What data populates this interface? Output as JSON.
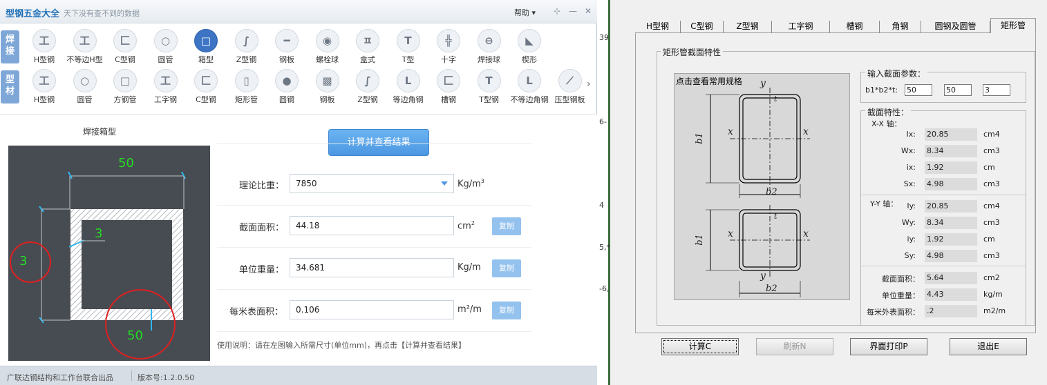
{
  "left_app": {
    "title": "型钢五金大全",
    "subtitle": "天下没有查不到的数据",
    "help_label": "帮助 ▾",
    "controls": {
      "pin": "⊹",
      "minimize": "—",
      "close": "✕"
    },
    "weld_row": {
      "tag": "焊\n接",
      "items": [
        {
          "label": "H型钢",
          "glyph": "工"
        },
        {
          "label": "不等边H型",
          "glyph": "工"
        },
        {
          "label": "C型钢",
          "glyph": "匚"
        },
        {
          "label": "圆管",
          "glyph": "○"
        },
        {
          "label": "箱型",
          "glyph": "□"
        },
        {
          "label": "Z型钢",
          "glyph": "∫"
        },
        {
          "label": "钢板",
          "glyph": "━"
        },
        {
          "label": "螺栓球",
          "glyph": "◉"
        },
        {
          "label": "盒式",
          "glyph": "ㅍ"
        },
        {
          "label": "T型",
          "glyph": "T"
        },
        {
          "label": "十字",
          "glyph": "╬"
        },
        {
          "label": "焊接球",
          "glyph": "⊖"
        },
        {
          "label": "楔形",
          "glyph": "◣"
        }
      ]
    },
    "section_row": {
      "tag": "型\n材",
      "items": [
        {
          "label": "H型钢",
          "glyph": "工"
        },
        {
          "label": "圆管",
          "glyph": "○"
        },
        {
          "label": "方钢管",
          "glyph": "□"
        },
        {
          "label": "工字钢",
          "glyph": "工"
        },
        {
          "label": "C型钢",
          "glyph": "匚"
        },
        {
          "label": "矩形管",
          "glyph": "▯"
        },
        {
          "label": "圆钢",
          "glyph": "●"
        },
        {
          "label": "钢板",
          "glyph": "▩"
        },
        {
          "label": "Z型钢",
          "glyph": "∫"
        },
        {
          "label": "等边角钢",
          "glyph": "L"
        },
        {
          "label": "槽钢",
          "glyph": "匚"
        },
        {
          "label": "T型钢",
          "glyph": "T"
        },
        {
          "label": "不等边角钢",
          "glyph": "L"
        },
        {
          "label": "压型钢板",
          "glyph": "⟋"
        }
      ]
    },
    "scroll_arrow": "›",
    "diagram_title": "焊接箱型",
    "diagram_dims": {
      "width": "50",
      "thickness_inner": "3",
      "thickness_side": "3",
      "bottom": "50"
    },
    "calc_button": "计算并查看结果",
    "fields": [
      {
        "label": "理论比重：",
        "value": "7850",
        "unit": "Kg/m",
        "unit_sup": "3",
        "has_dropdown": true,
        "has_copy": false
      },
      {
        "label": "截面面积：",
        "value": "44.18",
        "unit": "cm",
        "unit_sup": "2",
        "has_dropdown": false,
        "has_copy": true
      },
      {
        "label": "单位重量：",
        "value": "34.681",
        "unit": "Kg/m",
        "unit_sup": "",
        "has_dropdown": false,
        "has_copy": true
      },
      {
        "label": "每米表面积：",
        "value": "0.106",
        "unit": "m²/m",
        "unit_sup": "",
        "has_dropdown": false,
        "has_copy": true
      }
    ],
    "copy_label": "复制",
    "usage_note": "使用说明：请在左图输入所需尺寸(单位mm)，再点击【计算并查看结果】",
    "status_company": "广联达钢结构和工作台联合出品",
    "status_version": "版本号:1.2.0.50",
    "colors": {
      "accent": "#3d74c4",
      "button": "#5aa6ec",
      "dim_text": "#22dd22",
      "circle": "#e02020"
    }
  },
  "mid_strip": {
    "fragments": [
      "39",
      "6-",
      "4",
      "5,*",
      "-6,"
    ]
  },
  "right_app": {
    "tabs": [
      "H型钢",
      "C型钢",
      "Z型钢",
      "工字钢",
      "槽钢",
      "角钢",
      "圆钢及圆管",
      "矩形管"
    ],
    "active_tab": "矩形管",
    "group_title": "矩形管截面特性",
    "diagram_label": "点击查看常用规格",
    "diagram_letters": {
      "y": "y",
      "x": "x",
      "b1": "b1",
      "b2": "b2",
      "t": "t"
    },
    "input_group_title": "输入截面参数：",
    "param_label": "b1*b2*t:",
    "params": [
      "50",
      "50",
      "3"
    ],
    "props_title": "截面特性：",
    "xx_axis_label": "X-X 轴：",
    "yy_axis_label": "Y-Y 轴：",
    "xx_props": [
      {
        "name": "Ix:",
        "value": "20.85",
        "unit": "cm4"
      },
      {
        "name": "Wx:",
        "value": "8.34",
        "unit": "cm3"
      },
      {
        "name": "ix:",
        "value": "1.92",
        "unit": "cm"
      },
      {
        "name": "Sx:",
        "value": "4.98",
        "unit": "cm3"
      }
    ],
    "yy_props": [
      {
        "name": "Iy:",
        "value": "20.85",
        "unit": "cm4"
      },
      {
        "name": "Wy:",
        "value": "8.34",
        "unit": "cm3"
      },
      {
        "name": "iy:",
        "value": "1.92",
        "unit": "cm"
      },
      {
        "name": "Sy:",
        "value": "4.98",
        "unit": "cm3"
      }
    ],
    "summary_props": [
      {
        "name": "截面面积：",
        "value": "5.64",
        "unit": "cm2"
      },
      {
        "name": "单位重量：",
        "value": "4.43",
        "unit": "kg/m"
      },
      {
        "name": "每米外表面积：",
        "value": ".2",
        "unit": "m2/m"
      }
    ],
    "buttons": [
      {
        "label": "计算C",
        "state": "focused"
      },
      {
        "label": "刷新N",
        "state": "disabled"
      },
      {
        "label": "界面打印P",
        "state": "normal"
      },
      {
        "label": "退出E",
        "state": "normal"
      }
    ]
  }
}
